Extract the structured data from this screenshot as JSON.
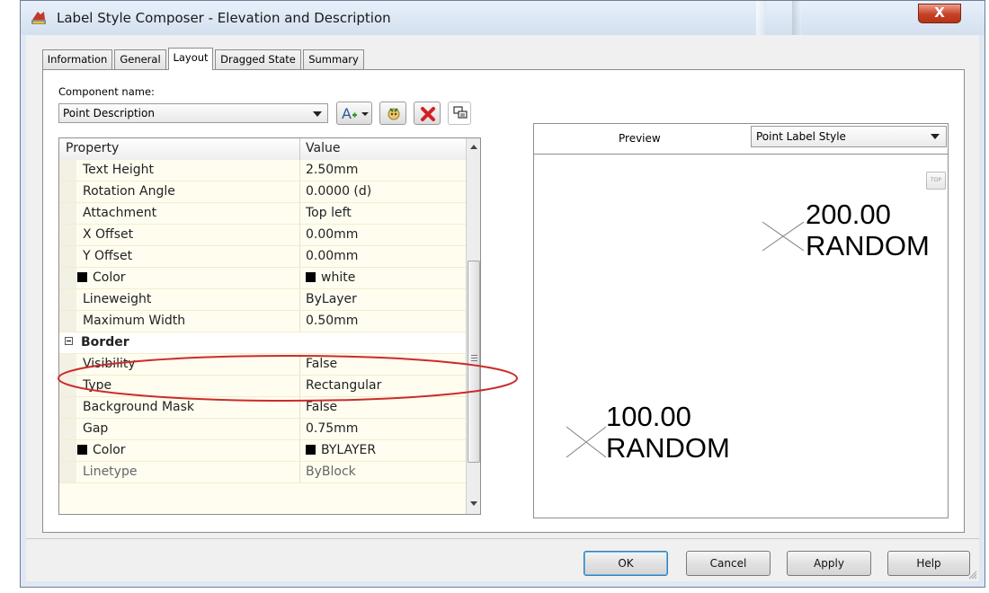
{
  "window": {
    "title": "Label Style Composer - Elevation and Description",
    "close_label": "X"
  },
  "tabs": [
    {
      "label": "Information"
    },
    {
      "label": "General"
    },
    {
      "label": "Layout"
    },
    {
      "label": "Dragged State"
    },
    {
      "label": "Summary"
    }
  ],
  "component": {
    "label": "Component name:",
    "value": "Point Description"
  },
  "grid": {
    "col_property": "Property",
    "col_value": "Value",
    "rows": [
      {
        "name": "Text Height",
        "value": "2.50mm"
      },
      {
        "name": "Rotation Angle",
        "value": "0.0000 (d)"
      },
      {
        "name": "Attachment",
        "value": "Top left"
      },
      {
        "name": "X Offset",
        "value": "0.00mm"
      },
      {
        "name": "Y Offset",
        "value": "0.00mm"
      },
      {
        "name": "Color",
        "value": "white"
      },
      {
        "name": "Lineweight",
        "value": "ByLayer"
      },
      {
        "name": "Maximum Width",
        "value": "0.50mm"
      },
      {
        "name": "Border",
        "value": ""
      },
      {
        "name": "Visibility",
        "value": "False"
      },
      {
        "name": "Type",
        "value": "Rectangular"
      },
      {
        "name": "Background Mask",
        "value": "False"
      },
      {
        "name": "Gap",
        "value": "0.75mm"
      },
      {
        "name": "Color",
        "value": "BYLAYER"
      },
      {
        "name": "Linetype",
        "value": "ByBlock"
      }
    ]
  },
  "preview": {
    "label": "Preview",
    "style_value": "Point Label Style",
    "top_button": "TOP",
    "point1": {
      "elevation": "200.00",
      "description": "RANDOM"
    },
    "point2": {
      "elevation": "100.00",
      "description": "RANDOM"
    }
  },
  "buttons": {
    "ok": "OK",
    "cancel": "Cancel",
    "apply": "Apply",
    "help": "Help"
  },
  "colors": {
    "highlight": "#cc2b2b",
    "title_gradient": "#d3e0ef",
    "close": "#c64125",
    "grid_bg": "#fffdf0"
  },
  "icons": [
    "composer-app-icon",
    "text-add-icon",
    "copy-component-icon",
    "delete-icon",
    "component-order-icon",
    "top-view-icon"
  ]
}
